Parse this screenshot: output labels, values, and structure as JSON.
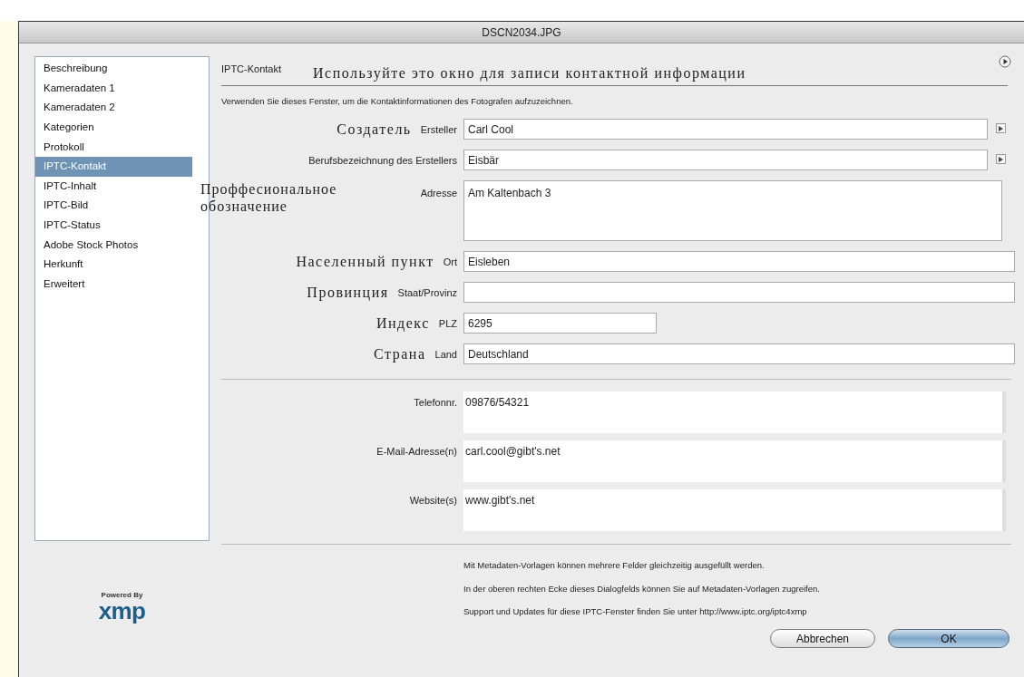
{
  "window": {
    "title": "DSCN2034.JPG"
  },
  "sidebar": {
    "items": [
      {
        "label": "Beschreibung",
        "selected": false
      },
      {
        "label": "Kameradaten 1",
        "selected": false
      },
      {
        "label": "Kameradaten 2",
        "selected": false
      },
      {
        "label": "Kategorien",
        "selected": false
      },
      {
        "label": "Protokoll",
        "selected": false
      },
      {
        "label": "IPTC-Kontakt",
        "selected": true
      },
      {
        "label": "IPTC-Inhalt",
        "selected": false
      },
      {
        "label": "IPTC-Bild",
        "selected": false
      },
      {
        "label": "IPTC-Status",
        "selected": false
      },
      {
        "label": "Adobe Stock Photos",
        "selected": false
      },
      {
        "label": "Herkunft",
        "selected": false
      },
      {
        "label": "Erweitert",
        "selected": false
      }
    ]
  },
  "logo": {
    "caption": "Powered By",
    "wordmark": "xmp"
  },
  "panel": {
    "title": "IPTC-Kontakt",
    "annotation": "Используйте это окно для записи контактной информации",
    "description": "Verwenden Sie dieses Fenster, um die Kontaktinformationen des Fotografen aufzuzeichnen."
  },
  "fields": [
    {
      "annotation": "Создатель",
      "label": "Ersteller",
      "value": "Carl Cool",
      "kind": "line",
      "menu": true
    },
    {
      "label": "Berufsbezeichnung des Erstellers",
      "value": "Eisbär",
      "kind": "line",
      "menu": true
    },
    {
      "annotation": "Проффесиональное обозначение",
      "label": "Adresse",
      "value": "Am Kaltenbach 3",
      "kind": "area",
      "menu": false
    },
    {
      "annotation": "Населенный пункт",
      "label": "Ort",
      "value": "Eisleben",
      "kind": "line",
      "menu": false
    },
    {
      "annotation": "Провинция",
      "label": "Staat/Provinz",
      "kind": "line",
      "menu": false
    },
    {
      "annotation": "Индекс",
      "label": "PLZ",
      "value": "6295",
      "kind": "short",
      "menu": false
    },
    {
      "annotation": "Страна",
      "label": "Land",
      "value": "Deutschland",
      "kind": "line",
      "menu": false
    }
  ],
  "contact_fields": [
    {
      "label": "Telefonnr.",
      "value": "09876/54321"
    },
    {
      "label": "E-Mail-Adresse(n)",
      "value": "carl.cool@gibt's.net"
    },
    {
      "label": "Website(s)",
      "value": "www.gibt's.net"
    }
  ],
  "notes": [
    "Mit Metadaten-Vorlagen können mehrere Felder gleichzeitig ausgefüllt werden.",
    "In der oberen rechten Ecke dieses Dialogfelds können Sie auf Metadaten-Vorlagen zugreifen.",
    "Support und Updates für diese IPTC-Fenster finden Sie unter http://www.iptc.org/iptc4xmp"
  ],
  "buttons": [
    {
      "label": "Abbrechen",
      "default": false
    },
    {
      "label": "OK",
      "default": true
    }
  ]
}
